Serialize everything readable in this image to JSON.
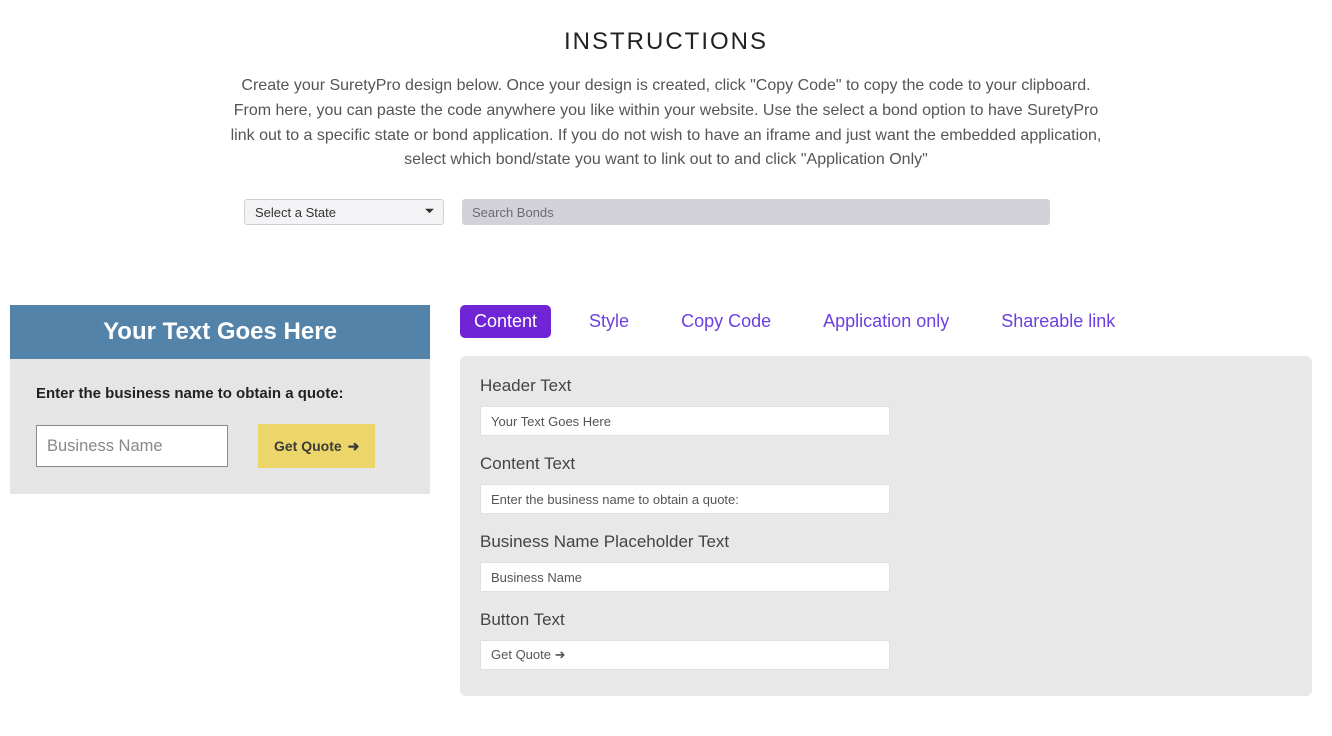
{
  "instructions": {
    "title": "INSTRUCTIONS",
    "body": "Create your SuretyPro design below. Once your design is created, click \"Copy Code\" to copy the code to your clipboard. From here, you can paste the code anywhere you like within your website. Use the select a bond option to have SuretyPro link out to a specific state or bond application. If you do not wish to have an iframe and just want the embedded application, select which bond/state you want to link out to and click \"Application Only\""
  },
  "controls": {
    "state_label": "Select a State",
    "search_placeholder": "Search Bonds"
  },
  "preview": {
    "header": "Your Text Goes Here",
    "content_label": "Enter the business name to obtain a quote:",
    "input_placeholder": "Business Name",
    "button_label": "Get Quote"
  },
  "tabs": {
    "content": "Content",
    "style": "Style",
    "copy_code": "Copy Code",
    "application_only": "Application only",
    "shareable_link": "Shareable link"
  },
  "fields": {
    "header_text": {
      "label": "Header Text",
      "value": "Your Text Goes Here"
    },
    "content_text": {
      "label": "Content Text",
      "value": "Enter the business name to obtain a quote:"
    },
    "placeholder_text": {
      "label": "Business Name Placeholder Text",
      "value": "Business Name"
    },
    "button_text": {
      "label": "Button Text",
      "value": "Get Quote ➜"
    }
  }
}
